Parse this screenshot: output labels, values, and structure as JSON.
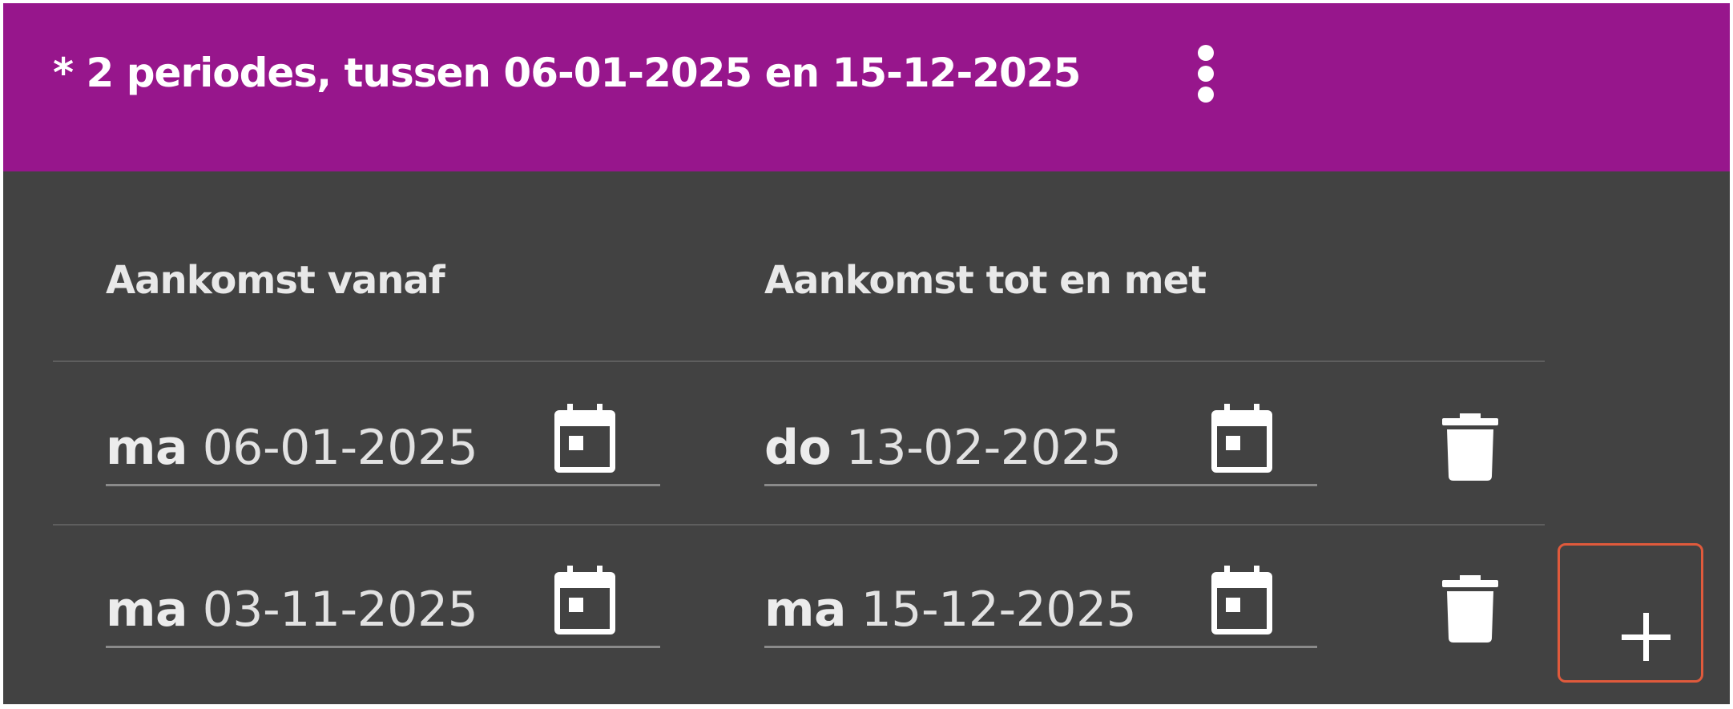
{
  "header": {
    "title": "* 2 periodes, tussen 06-01-2025 en 15-12-2025",
    "menu_icon": "more-vertical-icon"
  },
  "columns": {
    "from_label": "Aankomst vanaf",
    "to_label": "Aankomst tot en met"
  },
  "periods": [
    {
      "from": {
        "day": "ma",
        "date": "06-01-2025"
      },
      "to": {
        "day": "do",
        "date": "13-02-2025"
      }
    },
    {
      "from": {
        "day": "ma",
        "date": "03-11-2025"
      },
      "to": {
        "day": "ma",
        "date": "15-12-2025"
      }
    }
  ],
  "icons": {
    "calendar": "calendar-icon",
    "delete": "trash-icon",
    "add": "plus-icon"
  },
  "colors": {
    "header_bg": "#97168c",
    "panel_bg": "#424242",
    "add_border": "#e05a3c"
  }
}
